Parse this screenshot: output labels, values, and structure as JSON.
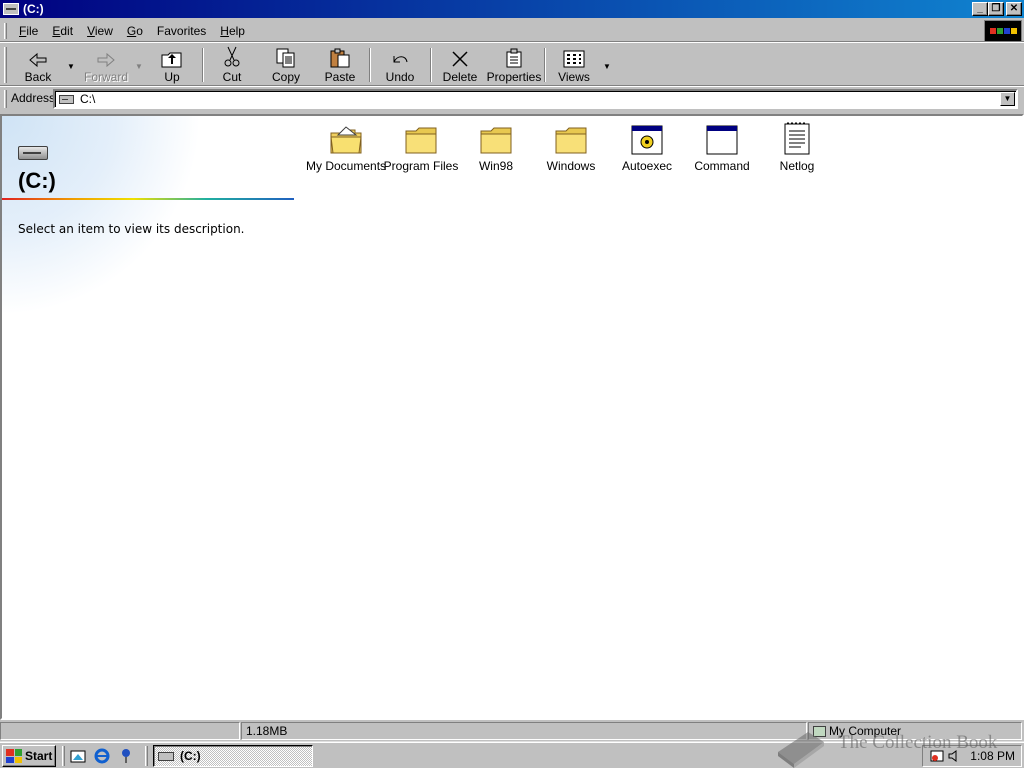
{
  "window": {
    "title": "(C:)"
  },
  "menu": [
    {
      "label": "File",
      "u": "F",
      "rest": "ile"
    },
    {
      "label": "Edit",
      "u": "E",
      "rest": "dit"
    },
    {
      "label": "View",
      "u": "V",
      "rest": "iew"
    },
    {
      "label": "Go",
      "u": "G",
      "rest": "o"
    },
    {
      "label": "Favorites",
      "u": "F",
      "rest": "avorites",
      "pre": ""
    },
    {
      "label": "Help",
      "u": "H",
      "rest": "elp"
    }
  ],
  "toolbar": {
    "back": "Back",
    "forward": "Forward",
    "up": "Up",
    "cut": "Cut",
    "copy": "Copy",
    "paste": "Paste",
    "undo": "Undo",
    "delete": "Delete",
    "properties": "Properties",
    "views": "Views"
  },
  "address": {
    "label": "Address",
    "value": "C:\\"
  },
  "left_panel": {
    "title": "(C:)",
    "description": "Select an item to view its description."
  },
  "items": [
    {
      "name": "My Documents",
      "icon": "my-documents-folder-icon"
    },
    {
      "name": "Program Files",
      "icon": "folder-icon"
    },
    {
      "name": "Win98",
      "icon": "folder-icon"
    },
    {
      "name": "Windows",
      "icon": "folder-icon"
    },
    {
      "name": "Autoexec",
      "icon": "batch-file-icon"
    },
    {
      "name": "Command",
      "icon": "ms-dos-program-icon"
    },
    {
      "name": "Netlog",
      "icon": "text-document-icon"
    }
  ],
  "status": {
    "size": "1.18MB",
    "zone": "My Computer"
  },
  "taskbar": {
    "start": "Start",
    "task": "(C:)",
    "clock": "1:08 PM"
  },
  "watermark": "The Collection Book"
}
